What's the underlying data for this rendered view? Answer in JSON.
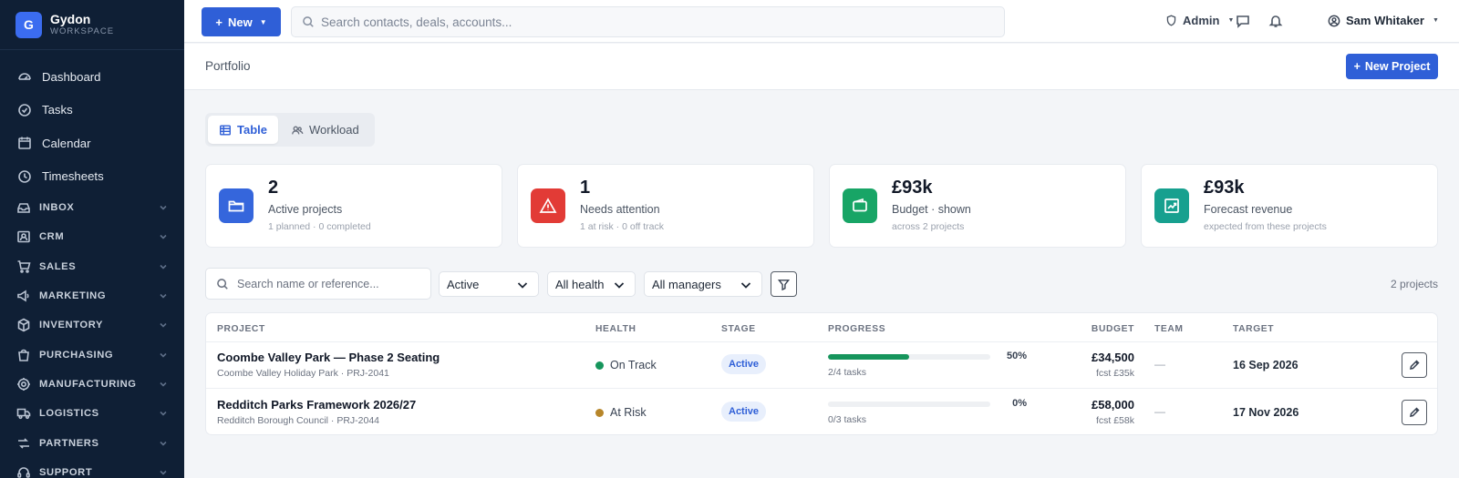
{
  "brand": {
    "initial": "G",
    "name": "Gydon",
    "sub": "WORKSPACE"
  },
  "sidebar": {
    "items": [
      {
        "label": "Dashboard",
        "icon": "dashboard-icon"
      },
      {
        "label": "Tasks",
        "icon": "tasks-icon"
      },
      {
        "label": "Calendar",
        "icon": "calendar-icon"
      },
      {
        "label": "Timesheets",
        "icon": "clock-icon"
      }
    ],
    "groups": [
      {
        "label": "INBOX",
        "icon": "inbox-icon"
      },
      {
        "label": "CRM",
        "icon": "contact-card-icon"
      },
      {
        "label": "SALES",
        "icon": "cart-icon"
      },
      {
        "label": "MARKETING",
        "icon": "megaphone-icon"
      },
      {
        "label": "INVENTORY",
        "icon": "boxes-icon"
      },
      {
        "label": "PURCHASING",
        "icon": "bag-icon"
      },
      {
        "label": "MANUFACTURING",
        "icon": "gear-icon"
      },
      {
        "label": "LOGISTICS",
        "icon": "truck-icon"
      },
      {
        "label": "PARTNERS",
        "icon": "handshake-icon"
      },
      {
        "label": "SUPPORT",
        "icon": "headset-icon"
      }
    ]
  },
  "topbar": {
    "new_label": "New",
    "search_placeholder": "Search contacts, deals, accounts...",
    "role": "Admin",
    "user": "Sam Whitaker"
  },
  "page": {
    "title": "Portfolio",
    "new_project_label": "New Project"
  },
  "views": {
    "table": "Table",
    "workload": "Workload"
  },
  "stats": [
    {
      "value": "2",
      "label": "Active projects",
      "sub": "1 planned · 0 completed",
      "color": "#3566dc"
    },
    {
      "value": "1",
      "label": "Needs attention",
      "sub": "1 at risk · 0 off track",
      "color": "#e23b36"
    },
    {
      "value": "£93k",
      "label": "Budget · shown",
      "sub": "across 2 projects",
      "color": "#18a566"
    },
    {
      "value": "£93k",
      "label": "Forecast revenue",
      "sub": "expected from these projects",
      "color": "#17a08f"
    }
  ],
  "filters": {
    "search_placeholder": "Search name or reference...",
    "status": "Active",
    "health": "All health",
    "manager": "All managers",
    "count_label": "2 projects"
  },
  "table": {
    "headers": [
      "PROJECT",
      "HEALTH",
      "STAGE",
      "PROGRESS",
      "BUDGET",
      "TEAM",
      "TARGET"
    ],
    "rows": [
      {
        "name": "Coombe Valley Park — Phase 2 Seating",
        "sub": "Coombe Valley Holiday Park · PRJ-2041",
        "health": "On Track",
        "health_color": "#16955c",
        "stage": "Active",
        "progress": 50,
        "progress_label": "50%",
        "tasks": "2/4 tasks",
        "budget": "£34,500",
        "forecast": "fcst £35k",
        "team": "—",
        "target": "16 Sep 2026"
      },
      {
        "name": "Redditch Parks Framework 2026/27",
        "sub": "Redditch Borough Council · PRJ-2044",
        "health": "At Risk",
        "health_color": "#b7862a",
        "stage": "Active",
        "progress": 0,
        "progress_label": "0%",
        "tasks": "0/3 tasks",
        "budget": "£58,000",
        "forecast": "fcst £58k",
        "team": "—",
        "target": "17 Nov 2026"
      }
    ]
  }
}
